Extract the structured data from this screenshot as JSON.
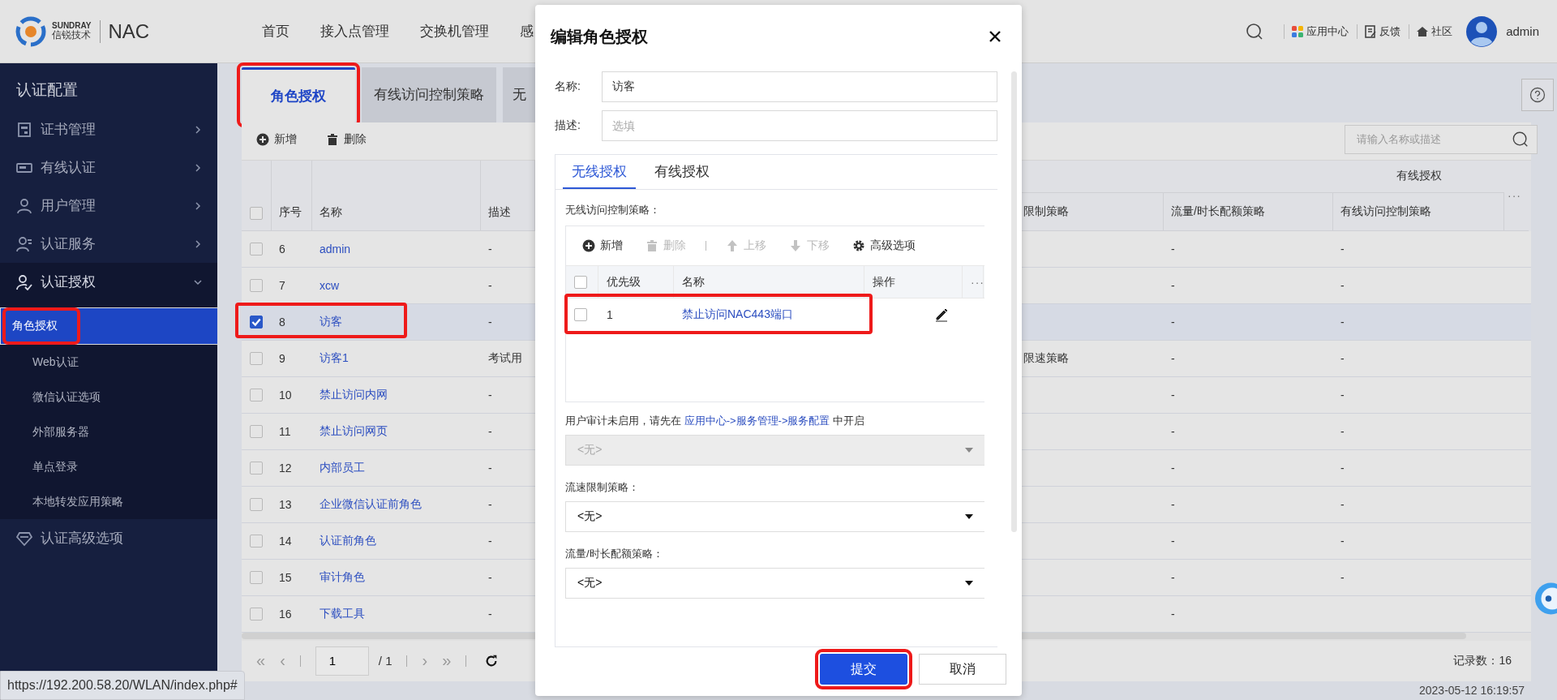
{
  "header": {
    "brand_top": "SUNDRAY",
    "brand_bottom": "信锐技术",
    "product": "NAC",
    "nav": [
      {
        "label": "首页"
      },
      {
        "label": "接入点管理"
      },
      {
        "label": "交换机管理"
      },
      {
        "label": "感"
      }
    ],
    "tools": [
      {
        "kind": "search"
      },
      {
        "kind": "apps",
        "label": "应用中心"
      },
      {
        "kind": "feedback",
        "label": "反馈"
      },
      {
        "kind": "community",
        "label": "社区"
      }
    ],
    "user": "admin"
  },
  "sidebar": {
    "title": "认证配置",
    "items": [
      {
        "label": "证书管理",
        "kind": "cert",
        "expanded": false
      },
      {
        "label": "有线认证",
        "kind": "card",
        "expanded": false
      },
      {
        "label": "用户管理",
        "kind": "user",
        "expanded": false
      },
      {
        "label": "认证服务",
        "kind": "users",
        "expanded": false
      },
      {
        "label": "认证授权",
        "kind": "auth",
        "expanded": true,
        "children": [
          {
            "label": "角色授权",
            "selected": true,
            "highlighted": true
          },
          {
            "label": "Web认证",
            "selected": false,
            "highlighted": false
          },
          {
            "label": "微信认证选项",
            "selected": false,
            "highlighted": false
          },
          {
            "label": "外部服务器",
            "selected": false,
            "highlighted": false
          },
          {
            "label": "单点登录",
            "selected": false,
            "highlighted": false
          },
          {
            "label": "本地转发应用策略",
            "selected": false,
            "highlighted": false
          }
        ]
      },
      {
        "label": "认证高级选项",
        "kind": "gem"
      }
    ]
  },
  "tabs": [
    {
      "label": "角色授权",
      "selected": true,
      "highlighted": true
    },
    {
      "label": "有线访问控制策略",
      "selected": false,
      "highlighted": false
    },
    {
      "label": "无",
      "selected": false
    }
  ],
  "toolbar": [
    {
      "kind": "add",
      "label": "新增"
    },
    {
      "kind": "delete",
      "label": "删除"
    }
  ],
  "search": {
    "placeholder": "请输入名称或描述"
  },
  "table": {
    "group_header": "有线授权",
    "all_selected": false,
    "more": "···",
    "columns": [
      "序号",
      "名称",
      "描述",
      "限制策略",
      "流量/时长配额策略",
      "有线访问控制策略"
    ],
    "rows": [
      {
        "no": "6",
        "name": "admin",
        "desc": "-",
        "quota": "-",
        "wired": "-",
        "selected": false,
        "highlighted": false
      },
      {
        "no": "7",
        "name": "xcw",
        "desc": "-",
        "quota": "-",
        "wired": "-",
        "selected": false,
        "highlighted": false
      },
      {
        "no": "8",
        "name": "访客",
        "desc": "-",
        "quota": "-",
        "wired": "-",
        "selected": true,
        "highlighted": true
      },
      {
        "no": "9",
        "name": "访客1",
        "desc": "考试用",
        "rate": "限速策略",
        "quota": "-",
        "wired": "-",
        "selected": false,
        "highlighted": false
      },
      {
        "no": "10",
        "name": "禁止访问内网",
        "desc": "-",
        "quota": "-",
        "wired": "-",
        "selected": false,
        "highlighted": false
      },
      {
        "no": "11",
        "name": "禁止访问网页",
        "desc": "-",
        "quota": "-",
        "wired": "-",
        "selected": false,
        "highlighted": false
      },
      {
        "no": "12",
        "name": "内部员工",
        "desc": "-",
        "quota": "-",
        "wired": "-",
        "selected": false,
        "highlighted": false
      },
      {
        "no": "13",
        "name": "企业微信认证前角色",
        "desc": "-",
        "quota": "-",
        "wired": "-",
        "selected": false,
        "highlighted": false
      },
      {
        "no": "14",
        "name": "认证前角色",
        "desc": "-",
        "quota": "-",
        "wired": "-",
        "selected": false,
        "highlighted": false
      },
      {
        "no": "15",
        "name": "审计角色",
        "desc": "-",
        "quota": "-",
        "wired": "-",
        "selected": false,
        "highlighted": false
      },
      {
        "no": "16",
        "name": "下载工具",
        "desc": "-",
        "quota": "-",
        "selected": false,
        "highlighted": false
      }
    ]
  },
  "pagination": {
    "first": "«",
    "previous": "‹",
    "next": "›",
    "last": "»",
    "page": "1",
    "total": "/ 1",
    "records": "记录数：16"
  },
  "status_url": "https://192.200.58.20/WLAN/index.php#",
  "timestamp": "2023-05-12 16:19:57",
  "modal": {
    "title": "编辑角色授权",
    "fields": [
      {
        "label": "名称:",
        "value": "访客"
      },
      {
        "label": "描述:",
        "placeholder": "选填"
      }
    ],
    "tabs": [
      {
        "label": "无线授权",
        "selected": true
      },
      {
        "label": "有线授权",
        "selected": false
      }
    ],
    "section_label": "无线访问控制策略：",
    "toolbar": [
      {
        "kind": "add",
        "label": "新增",
        "disabled": false
      },
      {
        "kind": "delete",
        "label": "删除",
        "disabled": true
      },
      {
        "kind": "up",
        "label": "上移",
        "disabled": true
      },
      {
        "kind": "down",
        "label": "下移",
        "disabled": true
      },
      {
        "kind": "gear",
        "label": "高级选项",
        "disabled": false
      }
    ],
    "columns": [
      "优先级",
      "名称",
      "操作"
    ],
    "all_checked": false,
    "more": "···",
    "rows": [
      {
        "priority": "1",
        "name": "禁止访问NAC443端口",
        "checked": false,
        "highlighted": true
      }
    ],
    "audit_note": {
      "before": "用户审计未启用，请先在",
      "link": "应用中心->服务管理->服务配置",
      "after": "中开启"
    },
    "selects": [
      {
        "value": "<无>",
        "disabled": true
      },
      {
        "label": "流速限制策略：",
        "value": "<无>",
        "disabled": false
      },
      {
        "label": "流量/时长配额策略：",
        "value": "<无>",
        "disabled": false
      }
    ],
    "buttons": [
      {
        "label": "提交",
        "kind": "primary",
        "highlighted": true
      },
      {
        "label": "取消",
        "kind": "default",
        "highlighted": false
      }
    ]
  }
}
